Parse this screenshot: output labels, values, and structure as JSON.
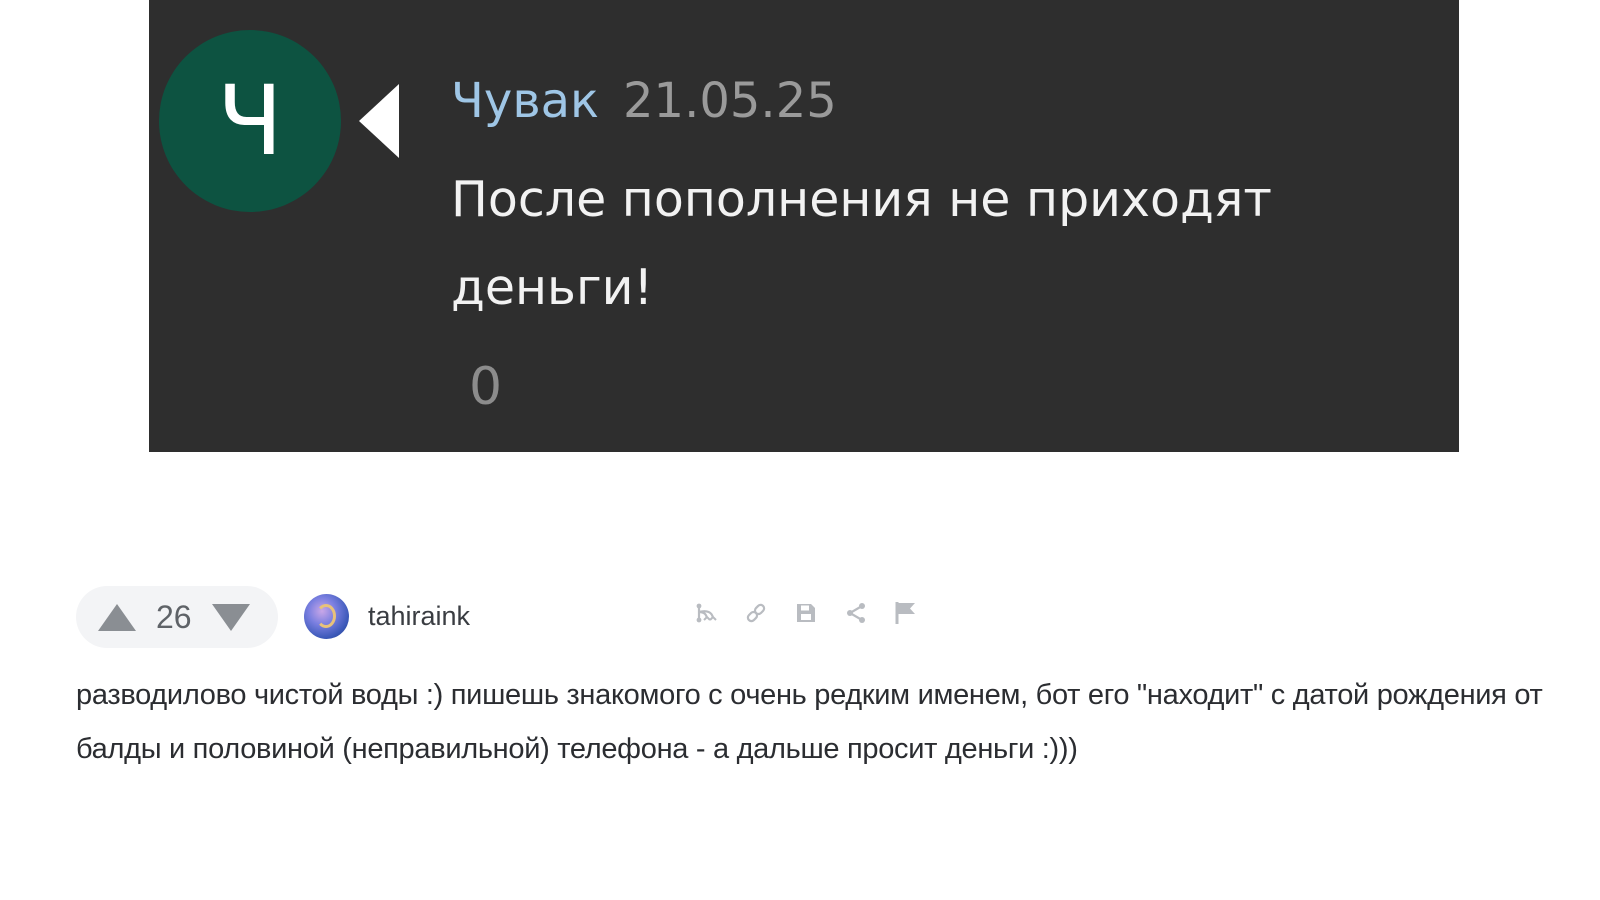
{
  "message": {
    "avatar_letter": "Ч",
    "avatar_color": "#0d5341",
    "author": "Чувак",
    "date": "21.05.25",
    "text": "После пополнения не приходят деньги!",
    "count": "0",
    "panel_color": "#2e2e2e"
  },
  "comment": {
    "rating": "26",
    "username": "tahiraink",
    "avatar_icon": "user-avatar-icon",
    "actions": [
      {
        "name": "thread-icon"
      },
      {
        "name": "link-icon"
      },
      {
        "name": "save-icon"
      },
      {
        "name": "share-icon"
      },
      {
        "name": "report-flag-icon"
      }
    ],
    "text": "разводилово чистой воды :) пишешь знакомого с очень редким именем, бот его \"находит\" с датой рождения от балды и половиной (неправильной) телефона - а дальше просит деньги :)))"
  }
}
